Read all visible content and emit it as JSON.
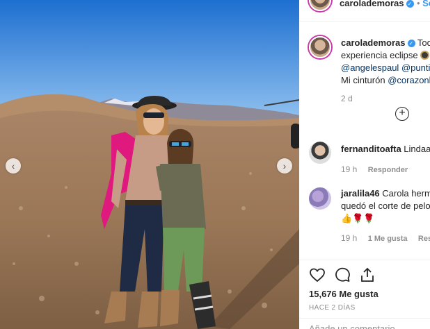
{
  "header": {
    "username": "carolademoras",
    "follow_label": "Seg"
  },
  "caption": {
    "username": "carolademoras",
    "line1_rest": "Todo",
    "line2": "experiencia eclipse",
    "line3_mention1": "@angelespaul",
    "line3_mention2": "@puntif",
    "line4_text": "Mi cinturón",
    "line4_mention": "@corazonh",
    "time": "2 d"
  },
  "comments": [
    {
      "username": "fernanditoafta",
      "text": "Lindaaa",
      "time": "19 h",
      "reply_label": "Responder"
    },
    {
      "username": "jaralila46",
      "text_line1": "Carola hermo",
      "text_line2": "quedó el corte de pelo",
      "emoji": "👍🌹🌹",
      "time": "19 h",
      "likes_label": "1 Me gusta",
      "reply_label": "Resp"
    }
  ],
  "actions": {
    "likes": "15,676 Me gusta",
    "date": "HACE 2 DÍAS"
  },
  "comment_input": {
    "placeholder": "Añade un comentario..."
  },
  "colors": {
    "accent_blue": "#3897f0",
    "mention_blue": "#003569",
    "story_ring": "#c837ab",
    "pink_scarf": "#e0197e"
  }
}
